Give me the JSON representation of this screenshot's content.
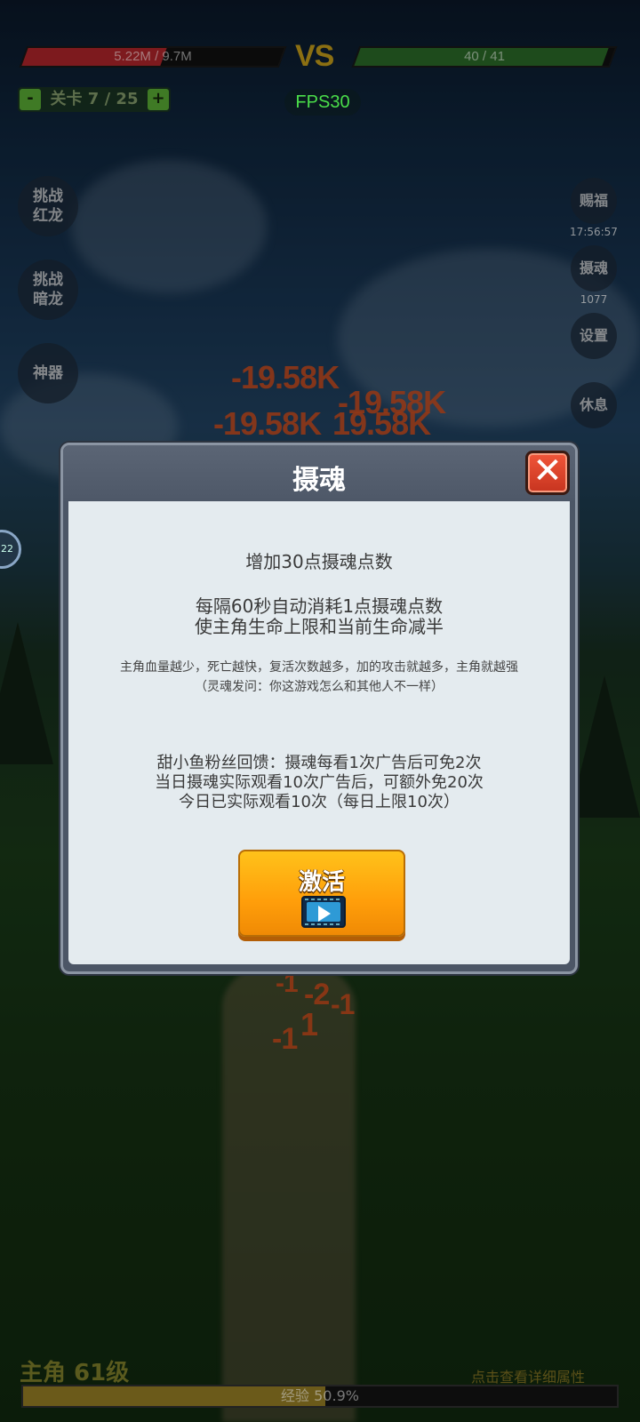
{
  "hud": {
    "player_hp_text": "5.22M / 9.7M",
    "player_hp_fraction": 0.54,
    "vs_label": "VS",
    "enemy_hp_text": "40 / 41",
    "enemy_hp_fraction": 0.976,
    "level_minus": "-",
    "level_text": "关卡 7 / 25",
    "level_plus": "+",
    "fps": "FPS30"
  },
  "left_buttons": [
    "挑战红龙",
    "挑战暗龙",
    "神器"
  ],
  "right_buttons": {
    "bless": {
      "label": "赐福",
      "sub": "17:56:57"
    },
    "soul": {
      "label": "摄魂",
      "sub": "1077"
    },
    "settings": {
      "label": "设置"
    },
    "rest": {
      "label": "休息"
    }
  },
  "damage_numbers": [
    "-19.58K",
    "-19.58K",
    "-19.58K",
    "19.58K",
    "-1",
    "-2",
    "-1",
    "-1",
    "1"
  ],
  "modal": {
    "title": "摄魂",
    "close_icon": "close-x-icon",
    "line1": "增加30点摄魂点数",
    "line2": "每隔60秒自动消耗1点摄魂点数",
    "line3": "使主角生命上限和当前生命减半",
    "line4": "主角血量越少，死亡越快，复活次数越多，加的攻击就越多，主角就越强",
    "line5": "（灵魂发问：你这游戏怎么和其他人不一样）",
    "line6": "甜小鱼粉丝回馈：摄魂每看1次广告后可免2次",
    "line7": "当日摄魂实际观看10次广告后，可额外免20次",
    "line8": "今日已实际观看10次（每日上限10次）",
    "activate_label": "激活",
    "activate_icon": "video-ad-icon"
  },
  "bottom": {
    "character": "主角 61级",
    "detail_link": "点击查看详细属性",
    "exp_text": "经验 50.9%",
    "exp_fraction": 0.509
  },
  "colors": {
    "accent_orange": "#ff9e0a",
    "close_red": "#e0462c",
    "fps_green": "#4ade4a"
  }
}
